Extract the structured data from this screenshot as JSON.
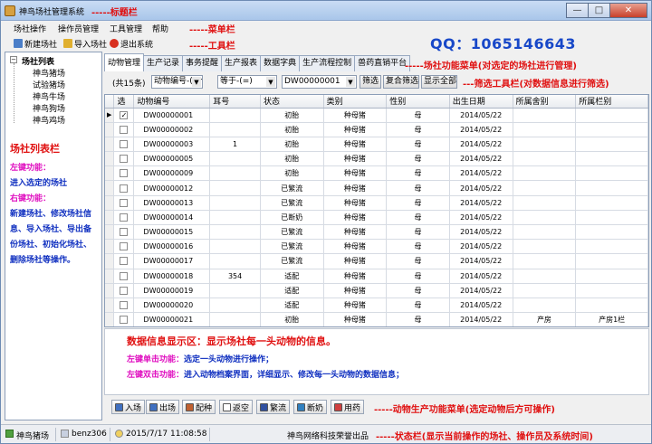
{
  "window": {
    "title": "神鸟场社管理系统",
    "title_annotation": "-----标题栏",
    "buttons": [
      "—",
      "□",
      "✕"
    ]
  },
  "menu": {
    "items": [
      "场社操作",
      "操作员管理",
      "工具管理",
      "帮助"
    ],
    "annotation": "-----菜单栏"
  },
  "toolbar": {
    "items": [
      "新建场社",
      "导入场社",
      "退出系统"
    ],
    "annotation": "-----工具栏"
  },
  "qq": "QQ：1065146643",
  "tree": {
    "root": "场社列表",
    "items": [
      "神鸟猪场",
      "试验猪场",
      "神鸟牛场",
      "神鸟狗场",
      "神鸟鸡场"
    ]
  },
  "left_notes": {
    "title": "场社列表栏",
    "left_click_label": "左键功能：",
    "left_click_text": "进入选定的场社",
    "right_click_label": "右键功能：",
    "right_click_lines": [
      "新建场社、修改场社信",
      "息、导入场社、导出备",
      "份场社、初始化场社、",
      "删除场社等操作。"
    ]
  },
  "tabs": {
    "items": [
      "动物管理",
      "生产记录",
      "事务提醒",
      "生产报表",
      "数据字典",
      "生产流程控制",
      "兽药直销平台"
    ],
    "active": 0,
    "annotation": "-----场社功能菜单(对选定的场社进行管理)"
  },
  "filter": {
    "count": "(共15条)",
    "field_select": "动物编号-(Ani",
    "op_select": "等于-(=)",
    "value": "DW00000001",
    "btn_filter": "筛选",
    "btn_compound": "复合筛选",
    "btn_show_all": "显示全部",
    "annotation": "---筛选工具栏(对数据信息进行筛选)"
  },
  "grid": {
    "columns": [
      "选",
      "动物编号",
      "耳号",
      "状态",
      "类别",
      "性别",
      "出生日期",
      "所属舍别",
      "所属栏别"
    ],
    "rows": [
      {
        "checked": true,
        "id": "DW00000001",
        "ear": "",
        "status": "初胎",
        "category": "种母猪",
        "sex": "母",
        "birth": "2014/05/22",
        "house": "",
        "pen": ""
      },
      {
        "checked": false,
        "id": "DW00000002",
        "ear": "",
        "status": "初胎",
        "category": "种母猪",
        "sex": "母",
        "birth": "2014/05/22",
        "house": "",
        "pen": ""
      },
      {
        "checked": false,
        "id": "DW00000003",
        "ear": "1",
        "status": "初胎",
        "category": "种母猪",
        "sex": "母",
        "birth": "2014/05/22",
        "house": "",
        "pen": ""
      },
      {
        "checked": false,
        "id": "DW00000005",
        "ear": "",
        "status": "初胎",
        "category": "种母猪",
        "sex": "母",
        "birth": "2014/05/22",
        "house": "",
        "pen": ""
      },
      {
        "checked": false,
        "id": "DW00000009",
        "ear": "",
        "status": "初胎",
        "category": "种母猪",
        "sex": "母",
        "birth": "2014/05/22",
        "house": "",
        "pen": ""
      },
      {
        "checked": false,
        "id": "DW00000012",
        "ear": "",
        "status": "已繁流",
        "category": "种母猪",
        "sex": "母",
        "birth": "2014/05/22",
        "house": "",
        "pen": ""
      },
      {
        "checked": false,
        "id": "DW00000013",
        "ear": "",
        "status": "已繁流",
        "category": "种母猪",
        "sex": "母",
        "birth": "2014/05/22",
        "house": "",
        "pen": ""
      },
      {
        "checked": false,
        "id": "DW00000014",
        "ear": "",
        "status": "已断奶",
        "category": "种母猪",
        "sex": "母",
        "birth": "2014/05/22",
        "house": "",
        "pen": ""
      },
      {
        "checked": false,
        "id": "DW00000015",
        "ear": "",
        "status": "已繁流",
        "category": "种母猪",
        "sex": "母",
        "birth": "2014/05/22",
        "house": "",
        "pen": ""
      },
      {
        "checked": false,
        "id": "DW00000016",
        "ear": "",
        "status": "已繁流",
        "category": "种母猪",
        "sex": "母",
        "birth": "2014/05/22",
        "house": "",
        "pen": ""
      },
      {
        "checked": false,
        "id": "DW00000017",
        "ear": "",
        "status": "已繁流",
        "category": "种母猪",
        "sex": "母",
        "birth": "2014/05/22",
        "house": "",
        "pen": ""
      },
      {
        "checked": false,
        "id": "DW00000018",
        "ear": "354",
        "status": "适配",
        "category": "种母猪",
        "sex": "母",
        "birth": "2014/05/22",
        "house": "",
        "pen": ""
      },
      {
        "checked": false,
        "id": "DW00000019",
        "ear": "",
        "status": "适配",
        "category": "种母猪",
        "sex": "母",
        "birth": "2014/05/22",
        "house": "",
        "pen": ""
      },
      {
        "checked": false,
        "id": "DW00000020",
        "ear": "",
        "status": "适配",
        "category": "种母猪",
        "sex": "母",
        "birth": "2014/05/22",
        "house": "",
        "pen": ""
      },
      {
        "checked": false,
        "id": "DW00000021",
        "ear": "",
        "status": "初胎",
        "category": "种母猪",
        "sex": "母",
        "birth": "2014/05/22",
        "house": "产房",
        "pen": "产房1栏"
      }
    ]
  },
  "info": {
    "heading": "数据信息显示区：显示场社每一头动物的信息。",
    "single_label": "左键单击功能：",
    "single_text": "选定一头动物进行操作；",
    "double_label": "左键双击功能：",
    "double_text": "进入动物档案界面，详细显示、修改每一头动物的数据信息；"
  },
  "funcbar": {
    "items": [
      "入场",
      "出场",
      "配种",
      "返空",
      "繁流",
      "断奶",
      "用药"
    ],
    "annotation": "-----动物生产功能菜单(选定动物后方可操作)"
  },
  "status": {
    "farm": "神鸟猪场",
    "operator": "benz306",
    "datetime": "2015/7/17 11:08:58",
    "company": "神鸟网络科技荣誉出品",
    "annotation": "-----状态栏(显示当前操作的场社、操作员及系统时间)"
  },
  "colors": {
    "annotation_red": "#e01010",
    "label_magenta": "#e010c0",
    "label_blue": "#1030c0",
    "qq_blue": "#1848c8"
  }
}
